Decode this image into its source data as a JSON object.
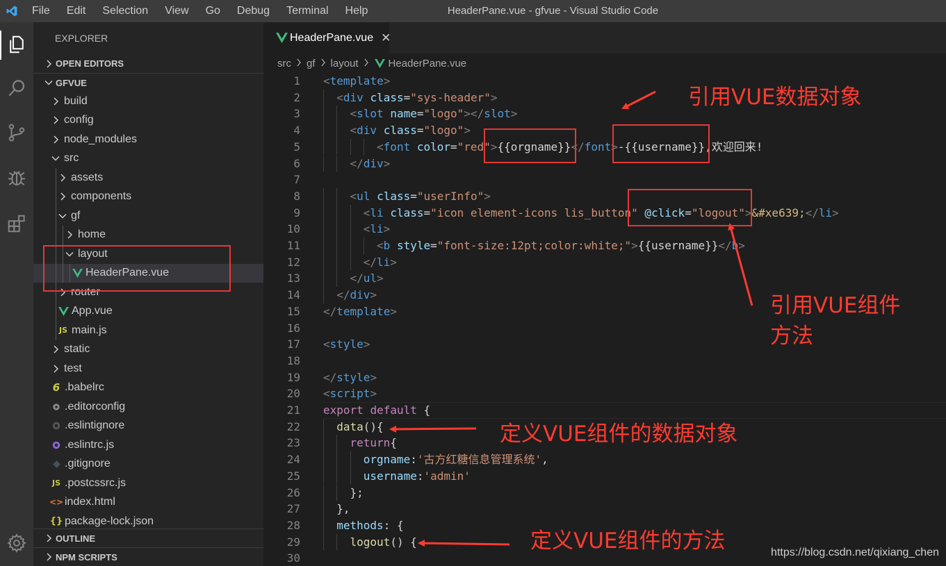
{
  "window": {
    "title": "HeaderPane.vue - gfvue - Visual Studio Code",
    "menu": [
      "File",
      "Edit",
      "Selection",
      "View",
      "Go",
      "Debug",
      "Terminal",
      "Help"
    ]
  },
  "activity_bar": {
    "icons": [
      "explorer-icon",
      "search-icon",
      "source-control-icon",
      "debug-icon",
      "extensions-icon",
      "gear-icon"
    ]
  },
  "sidebar": {
    "title": "EXPLORER",
    "sections": {
      "open_editors": "OPEN EDITORS",
      "project": "GFVUE",
      "outline": "OUTLINE",
      "npm_scripts": "NPM SCRIPTS"
    },
    "tree": [
      {
        "label": "build",
        "type": "folder",
        "depth": 1,
        "open": false
      },
      {
        "label": "config",
        "type": "folder",
        "depth": 1,
        "open": false
      },
      {
        "label": "node_modules",
        "type": "folder",
        "depth": 1,
        "open": false
      },
      {
        "label": "src",
        "type": "folder",
        "depth": 1,
        "open": true
      },
      {
        "label": "assets",
        "type": "folder",
        "depth": 2,
        "open": false
      },
      {
        "label": "components",
        "type": "folder",
        "depth": 2,
        "open": false
      },
      {
        "label": "gf",
        "type": "folder",
        "depth": 2,
        "open": true
      },
      {
        "label": "home",
        "type": "folder",
        "depth": 3,
        "open": false
      },
      {
        "label": "layout",
        "type": "folder",
        "depth": 3,
        "open": true
      },
      {
        "label": "HeaderPane.vue",
        "type": "vue",
        "depth": 4,
        "selected": true
      },
      {
        "label": "router",
        "type": "folder",
        "depth": 2,
        "open": false
      },
      {
        "label": "App.vue",
        "type": "vue",
        "depth": 2
      },
      {
        "label": "main.js",
        "type": "js",
        "depth": 2
      },
      {
        "label": "static",
        "type": "folder",
        "depth": 1,
        "open": false
      },
      {
        "label": "test",
        "type": "folder",
        "depth": 1,
        "open": false
      },
      {
        "label": ".babelrc",
        "type": "babel",
        "depth": 1
      },
      {
        "label": ".editorconfig",
        "type": "editorconfig",
        "depth": 1
      },
      {
        "label": ".eslintignore",
        "type": "eslintignore",
        "depth": 1
      },
      {
        "label": ".eslintrc.js",
        "type": "eslint",
        "depth": 1
      },
      {
        "label": ".gitignore",
        "type": "git",
        "depth": 1
      },
      {
        "label": ".postcssrc.js",
        "type": "js",
        "depth": 1
      },
      {
        "label": "index.html",
        "type": "html",
        "depth": 1
      },
      {
        "label": "package-lock.json",
        "type": "json",
        "depth": 1
      }
    ]
  },
  "tab": {
    "label": "HeaderPane.vue",
    "close": "✕"
  },
  "breadcrumb": [
    "src",
    "gf",
    "layout",
    "HeaderPane.vue"
  ],
  "code_lines": [
    {
      "n": "1",
      "indent": 0,
      "tokens": [
        [
          "<",
          "p"
        ],
        [
          "template",
          "t"
        ],
        [
          ">",
          "p"
        ]
      ]
    },
    {
      "n": "2",
      "indent": 1,
      "tokens": [
        [
          "<",
          "p"
        ],
        [
          "div",
          "t"
        ],
        [
          " ",
          "x"
        ],
        [
          "class",
          "a"
        ],
        [
          "=",
          "x"
        ],
        [
          "\"sys-header\"",
          "s"
        ],
        [
          ">",
          "p"
        ]
      ]
    },
    {
      "n": "3",
      "indent": 2,
      "tokens": [
        [
          "<",
          "p"
        ],
        [
          "slot",
          "t"
        ],
        [
          " ",
          "x"
        ],
        [
          "name",
          "a"
        ],
        [
          "=",
          "x"
        ],
        [
          "\"logo\"",
          "s"
        ],
        [
          "></",
          "p"
        ],
        [
          "slot",
          "t"
        ],
        [
          ">",
          "p"
        ]
      ]
    },
    {
      "n": "4",
      "indent": 2,
      "tokens": [
        [
          "<",
          "p"
        ],
        [
          "div",
          "t"
        ],
        [
          " ",
          "x"
        ],
        [
          "class",
          "a"
        ],
        [
          "=",
          "x"
        ],
        [
          "\"logo\"",
          "s"
        ],
        [
          ">",
          "p"
        ]
      ]
    },
    {
      "n": "5",
      "indent": 4,
      "tokens": [
        [
          "<",
          "p"
        ],
        [
          "font",
          "t"
        ],
        [
          " ",
          "x"
        ],
        [
          "color",
          "a"
        ],
        [
          "=",
          "x"
        ],
        [
          "\"red\"",
          "s"
        ],
        [
          ">",
          "p"
        ],
        [
          "{{orgname}}",
          "x"
        ],
        [
          "</",
          "p"
        ],
        [
          "font",
          "t"
        ],
        [
          ">",
          "p"
        ],
        [
          "-{{username}},欢迎回来!",
          "x"
        ]
      ]
    },
    {
      "n": "6",
      "indent": 2,
      "tokens": [
        [
          "</",
          "p"
        ],
        [
          "div",
          "t"
        ],
        [
          ">",
          "p"
        ]
      ]
    },
    {
      "n": "7",
      "indent": 0,
      "tokens": []
    },
    {
      "n": "8",
      "indent": 2,
      "tokens": [
        [
          "<",
          "p"
        ],
        [
          "ul",
          "t"
        ],
        [
          " ",
          "x"
        ],
        [
          "class",
          "a"
        ],
        [
          "=",
          "x"
        ],
        [
          "\"userInfo\"",
          "s"
        ],
        [
          ">",
          "p"
        ]
      ]
    },
    {
      "n": "9",
      "indent": 3,
      "tokens": [
        [
          "<",
          "p"
        ],
        [
          "li",
          "t"
        ],
        [
          " ",
          "x"
        ],
        [
          "class",
          "a"
        ],
        [
          "=",
          "x"
        ],
        [
          "\"icon element-icons lis_button\"",
          "s"
        ],
        [
          " ",
          "x"
        ],
        [
          "@click",
          "a"
        ],
        [
          "=",
          "x"
        ],
        [
          "\"logout\"",
          "s"
        ],
        [
          ">",
          "p"
        ],
        [
          "&#xe639;",
          "e"
        ],
        [
          "</",
          "p"
        ],
        [
          "li",
          "t"
        ],
        [
          ">",
          "p"
        ]
      ]
    },
    {
      "n": "10",
      "indent": 3,
      "tokens": [
        [
          "<",
          "p"
        ],
        [
          "li",
          "t"
        ],
        [
          ">",
          "p"
        ]
      ]
    },
    {
      "n": "11",
      "indent": 4,
      "tokens": [
        [
          "<",
          "p"
        ],
        [
          "b",
          "t"
        ],
        [
          " ",
          "x"
        ],
        [
          "style",
          "a"
        ],
        [
          "=",
          "x"
        ],
        [
          "\"font-size:12pt;color:white;\"",
          "s"
        ],
        [
          ">",
          "p"
        ],
        [
          "{{username}}",
          "x"
        ],
        [
          "</",
          "p"
        ],
        [
          "b",
          "t"
        ],
        [
          ">",
          "p"
        ]
      ]
    },
    {
      "n": "12",
      "indent": 3,
      "tokens": [
        [
          "</",
          "p"
        ],
        [
          "li",
          "t"
        ],
        [
          ">",
          "p"
        ]
      ]
    },
    {
      "n": "13",
      "indent": 2,
      "tokens": [
        [
          "</",
          "p"
        ],
        [
          "ul",
          "t"
        ],
        [
          ">",
          "p"
        ]
      ]
    },
    {
      "n": "14",
      "indent": 1,
      "tokens": [
        [
          "</",
          "p"
        ],
        [
          "div",
          "t"
        ],
        [
          ">",
          "p"
        ]
      ]
    },
    {
      "n": "15",
      "indent": 0,
      "tokens": [
        [
          "</",
          "p"
        ],
        [
          "template",
          "t"
        ],
        [
          ">",
          "p"
        ]
      ]
    },
    {
      "n": "16",
      "indent": 0,
      "tokens": []
    },
    {
      "n": "17",
      "indent": 0,
      "tokens": [
        [
          "<",
          "p"
        ],
        [
          "style",
          "t"
        ],
        [
          ">",
          "p"
        ]
      ]
    },
    {
      "n": "18",
      "indent": 0,
      "tokens": []
    },
    {
      "n": "19",
      "indent": 0,
      "tokens": [
        [
          "</",
          "p"
        ],
        [
          "style",
          "t"
        ],
        [
          ">",
          "p"
        ]
      ]
    },
    {
      "n": "20",
      "indent": 0,
      "tokens": [
        [
          "<",
          "p"
        ],
        [
          "script",
          "t"
        ],
        [
          ">",
          "p"
        ]
      ]
    },
    {
      "n": "21",
      "indent": 0,
      "tokens": [
        [
          "export",
          "k"
        ],
        [
          " ",
          "x"
        ],
        [
          "default",
          "k"
        ],
        [
          " {",
          "x"
        ]
      ]
    },
    {
      "n": "22",
      "indent": 1,
      "tokens": [
        [
          "data",
          "f"
        ],
        [
          "(){",
          "x"
        ]
      ]
    },
    {
      "n": "23",
      "indent": 2,
      "tokens": [
        [
          "return",
          "k"
        ],
        [
          "{",
          "x"
        ]
      ]
    },
    {
      "n": "24",
      "indent": 3,
      "tokens": [
        [
          "orgname",
          "v"
        ],
        [
          ":",
          "x"
        ],
        [
          "'古方红糖信息管理系统'",
          "s"
        ],
        [
          ",",
          "x"
        ]
      ]
    },
    {
      "n": "25",
      "indent": 3,
      "tokens": [
        [
          "username",
          "v"
        ],
        [
          ":",
          "x"
        ],
        [
          "'admin'",
          "s"
        ]
      ]
    },
    {
      "n": "26",
      "indent": 2,
      "tokens": [
        [
          "};",
          "x"
        ]
      ]
    },
    {
      "n": "27",
      "indent": 1,
      "tokens": [
        [
          "},",
          "x"
        ]
      ]
    },
    {
      "n": "28",
      "indent": 1,
      "tokens": [
        [
          "methods",
          "v"
        ],
        [
          ": {",
          "x"
        ]
      ]
    },
    {
      "n": "29",
      "indent": 2,
      "tokens": [
        [
          "logout",
          "f"
        ],
        [
          "() {",
          "x"
        ]
      ]
    },
    {
      "n": "30",
      "indent": 0,
      "tokens": []
    }
  ],
  "syntax_colors": {
    "p": "#808080",
    "t": "#569cd6",
    "a": "#9cdcfe",
    "s": "#ce9178",
    "x": "#d4d4d4",
    "k": "#c586c0",
    "f": "#dcdcaa",
    "v": "#9cdcfe",
    "e": "#d7ba7d"
  },
  "annotations": {
    "ref_data": "引用VUE数据对象",
    "ref_method_1": "引用VUE组件",
    "ref_method_2": "方法",
    "def_data": "定义VUE组件的数据对象",
    "def_method": "定义VUE组件的方法",
    "color": "#ff3b30"
  },
  "watermark": "https://blog.csdn.net/qixiang_chen"
}
